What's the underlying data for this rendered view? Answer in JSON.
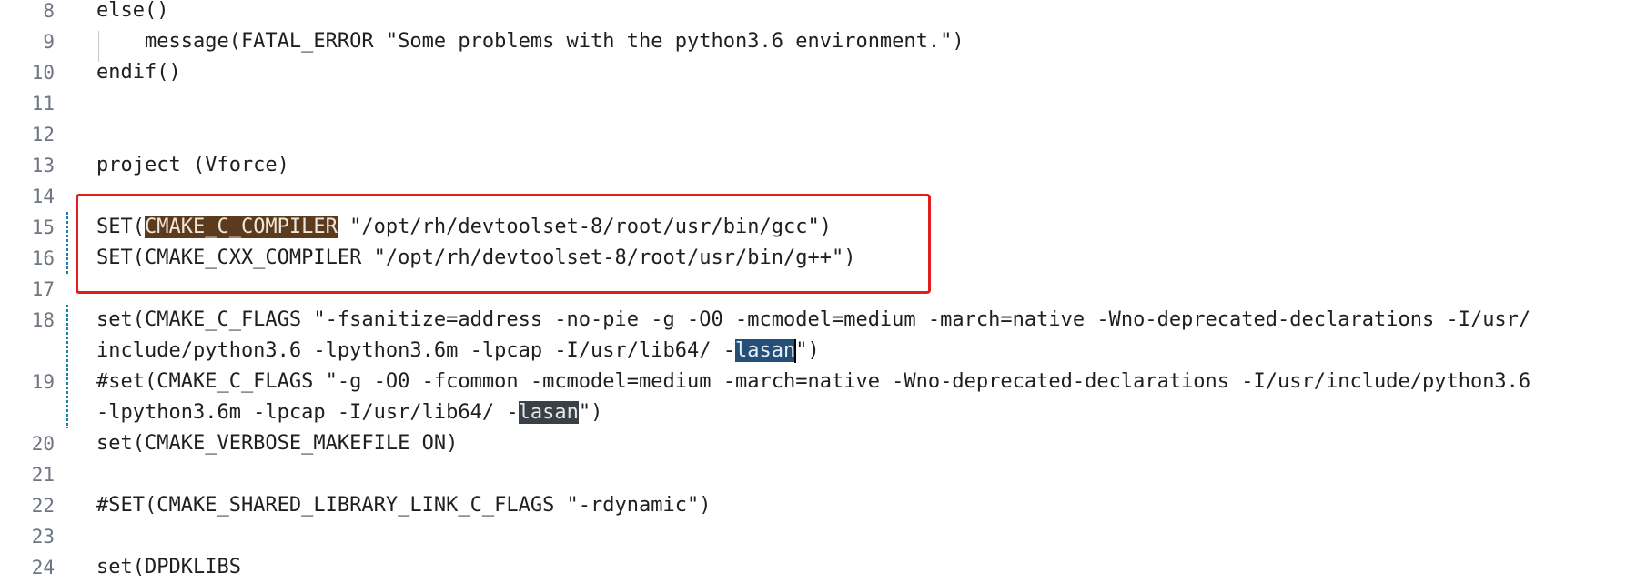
{
  "editor": {
    "lines": [
      {
        "num": "8",
        "text": "else()"
      },
      {
        "num": "9",
        "text": "    message(FATAL_ERROR \"Some problems with the python3.6 environment.\")"
      },
      {
        "num": "10",
        "text": "endif()"
      },
      {
        "num": "11",
        "text": ""
      },
      {
        "num": "12",
        "text": ""
      },
      {
        "num": "13",
        "text": "project (Vforce)"
      },
      {
        "num": "14",
        "text": ""
      },
      {
        "num": "15",
        "pre": "SET(",
        "hl": "CMAKE_C_COMPILER",
        "post": " \"/opt/rh/devtoolset-8/root/usr/bin/gcc\")"
      },
      {
        "num": "16",
        "text": "SET(CMAKE_CXX_COMPILER \"/opt/rh/devtoolset-8/root/usr/bin/g++\")"
      },
      {
        "num": "17",
        "text": ""
      },
      {
        "num": "18",
        "text": "set(CMAKE_C_FLAGS \"-fsanitize=address -no-pie -g -O0 -mcmodel=medium -march=native -Wno-deprecated-declarations -I/usr/"
      },
      {
        "num": "",
        "pre": "include/python3.6 -lpython3.6m -lpcap -I/usr/lib64/ -",
        "hl": "lasan",
        "post": "\")"
      },
      {
        "num": "19",
        "text": "#set(CMAKE_C_FLAGS \"-g -O0 -fcommon -mcmodel=medium -march=native -Wno-deprecated-declarations -I/usr/include/python3.6"
      },
      {
        "num": "",
        "pre": "-lpython3.6m -lpcap -I/usr/lib64/ -",
        "hl": "lasan",
        "post": "\")"
      },
      {
        "num": "20",
        "text": "set(CMAKE_VERBOSE_MAKEFILE ON)"
      },
      {
        "num": "21",
        "text": ""
      },
      {
        "num": "22",
        "text": "#SET(CMAKE_SHARED_LIBRARY_LINK_C_FLAGS \"-rdynamic\")"
      },
      {
        "num": "23",
        "text": ""
      },
      {
        "num": "24",
        "text": "set(DPDKLIBS"
      }
    ]
  },
  "colors": {
    "annotation_box": "#e01e1e",
    "selection_highlight": "#264f78",
    "word_highlight_brown": "#5b3a1e",
    "word_highlight_gray": "#3a4048",
    "line_number": "#6e7681",
    "gutter_change_marker": "#1b81a8"
  }
}
